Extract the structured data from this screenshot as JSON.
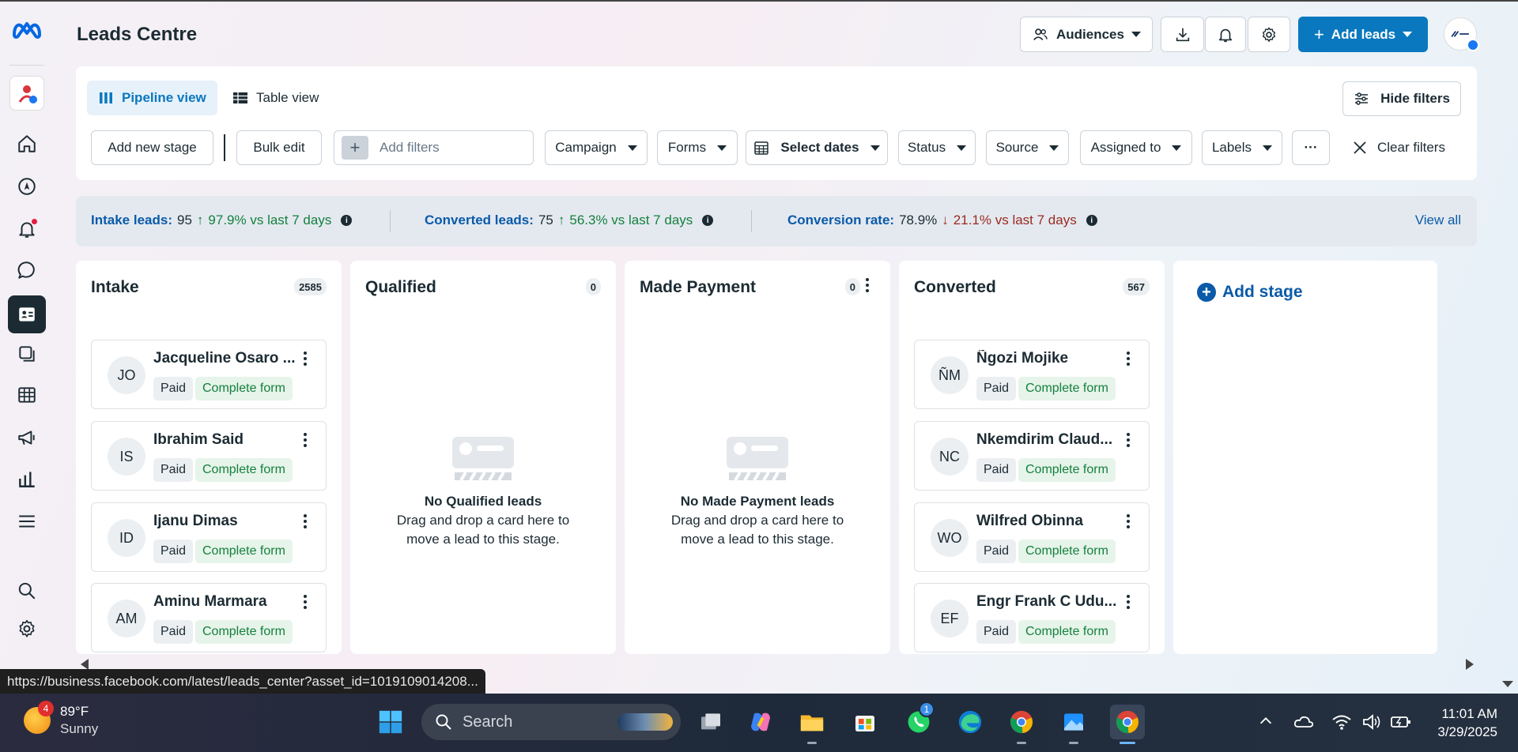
{
  "header": {
    "title": "Leads Centre",
    "audiences_label": "Audiences",
    "add_leads_label": "Add leads"
  },
  "views": {
    "pipeline_label": "Pipeline view",
    "table_label": "Table view",
    "hide_filters_label": "Hide filters"
  },
  "filters": {
    "add_new_stage": "Add new stage",
    "bulk_edit": "Bulk edit",
    "add_filters_placeholder": "Add filters",
    "campaign": "Campaign",
    "forms": "Forms",
    "select_dates": "Select dates",
    "status": "Status",
    "source": "Source",
    "assigned_to": "Assigned to",
    "labels": "Labels",
    "more": "···",
    "clear_filters": "Clear filters"
  },
  "stats": {
    "intake": {
      "label": "Intake leads:",
      "value": "95",
      "delta": "97.9% vs last 7 days"
    },
    "converted": {
      "label": "Converted leads:",
      "value": "75",
      "delta": "56.3% vs last 7 days"
    },
    "rate": {
      "label": "Conversion rate:",
      "value": "78.9%",
      "delta": "21.1% vs last 7 days"
    },
    "view_all": "View all"
  },
  "columns": [
    {
      "title": "Intake",
      "count": "2585",
      "cards": [
        {
          "initials": "JO",
          "name": "Jacqueline Osaro ...",
          "tag1": "Paid",
          "tag2": "Complete form"
        },
        {
          "initials": "IS",
          "name": "Ibrahim Said",
          "tag1": "Paid",
          "tag2": "Complete form"
        },
        {
          "initials": "ID",
          "name": "Ijanu Dimas",
          "tag1": "Paid",
          "tag2": "Complete form"
        },
        {
          "initials": "AM",
          "name": "Aminu Marmara",
          "tag1": "Paid",
          "tag2": "Complete form"
        }
      ]
    },
    {
      "title": "Qualified",
      "count": "0",
      "empty_title": "No Qualified leads",
      "empty_sub": "Drag and drop a card here to move a lead to this stage."
    },
    {
      "title": "Made Payment",
      "count": "0",
      "empty_title": "No Made Payment leads",
      "empty_sub": "Drag and drop a card here to move a lead to this stage."
    },
    {
      "title": "Converted",
      "count": "567",
      "cards": [
        {
          "initials": "ÑM",
          "name": "Ñgozi Mojike",
          "tag1": "Paid",
          "tag2": "Complete form"
        },
        {
          "initials": "NC",
          "name": "Nkemdirim Claud...",
          "tag1": "Paid",
          "tag2": "Complete form"
        },
        {
          "initials": "WO",
          "name": "Wilfred Obinna",
          "tag1": "Paid",
          "tag2": "Complete form"
        },
        {
          "initials": "EF",
          "name": "Engr Frank C Udu...",
          "tag1": "Paid",
          "tag2": "Complete form"
        }
      ]
    }
  ],
  "add_stage_label": "Add stage",
  "status_url": "https://business.facebook.com/latest/leads_center?asset_id=1019109014208...",
  "taskbar": {
    "weather_badge": "4",
    "temp": "89°F",
    "condition": "Sunny",
    "search_placeholder": "Search",
    "whatsapp_badge": "1",
    "time": "11:01 AM",
    "date": "3/29/2025"
  },
  "colors": {
    "accent": "#0a78be",
    "link": "#0a5aa8",
    "positive": "#15803d",
    "negative": "#9a2b1e"
  },
  "icons": [
    "meta-logo",
    "home-icon",
    "compass-icon",
    "bell-icon",
    "chat-icon",
    "leads-icon",
    "layers-icon",
    "table-icon",
    "megaphone-icon",
    "chart-icon",
    "menu-icon",
    "search-icon",
    "gear-icon"
  ]
}
